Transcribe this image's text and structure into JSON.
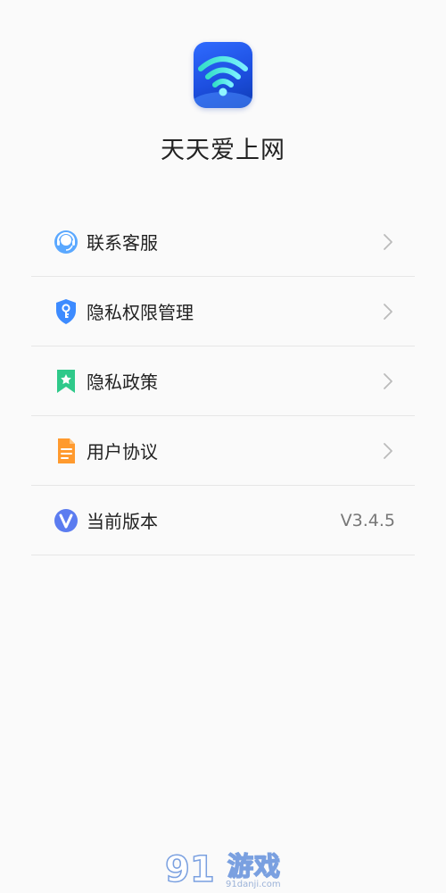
{
  "app": {
    "name": "天天爱上网",
    "icon": "wifi-globe-icon"
  },
  "menu": {
    "items": [
      {
        "label": "联系客服",
        "icon": "headset-icon",
        "has_chevron": true
      },
      {
        "label": "隐私权限管理",
        "icon": "shield-key-icon",
        "has_chevron": true
      },
      {
        "label": "隐私政策",
        "icon": "bookmark-star-icon",
        "has_chevron": true
      },
      {
        "label": "用户协议",
        "icon": "document-icon",
        "has_chevron": true
      },
      {
        "label": "当前版本",
        "icon": "v-logo-icon",
        "value": "V3.4.5"
      }
    ]
  },
  "watermark": {
    "number": "91",
    "text": "游戏",
    "sub": "91danji.com"
  },
  "colors": {
    "background": "#fafafa",
    "divider": "#e6e6e6",
    "text": "#222222",
    "muted": "#777777",
    "chevron": "#bbbbbb",
    "app_icon_blue": "#2f6bff"
  }
}
